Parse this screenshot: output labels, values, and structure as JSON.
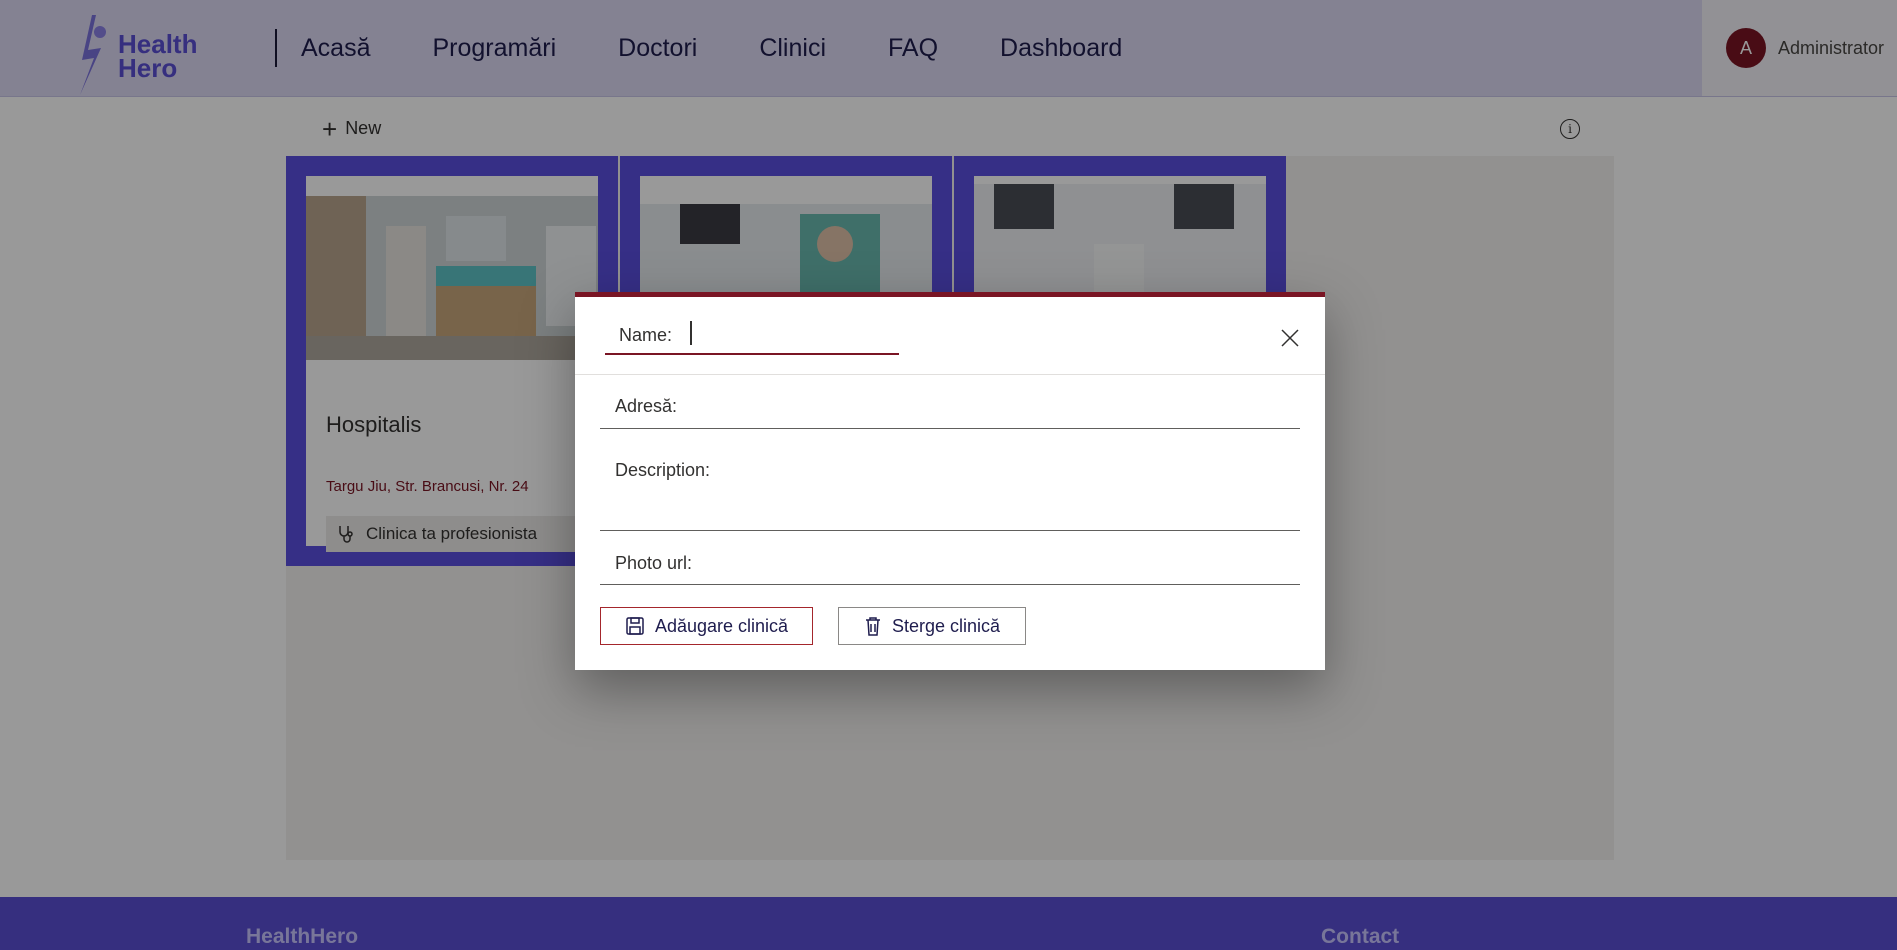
{
  "header": {
    "logo_line1": "Health",
    "logo_line2": "Hero",
    "nav": [
      "Acasă",
      "Programări",
      "Doctori",
      "Clinici",
      "FAQ",
      "Dashboard"
    ],
    "user_initial": "A",
    "user_name": "Administrator"
  },
  "toolbar": {
    "new_label": "New",
    "info_glyph": "i"
  },
  "cards": [
    {
      "title": "Hospitalis",
      "address": "Targu Jiu, Str. Brancusi, Nr. 24",
      "tag": "Clinica ta profesionista"
    },
    {
      "title": "",
      "address": "",
      "tag": ""
    },
    {
      "title": "",
      "address": "",
      "tag": ""
    }
  ],
  "modal": {
    "name_label": "Name:",
    "address_label": "Adresă:",
    "description_label": "Description:",
    "photo_label": "Photo url:",
    "save_label": "Adăugare clinică",
    "delete_label": "Sterge clinică"
  },
  "footer": {
    "brand": "HealthHero",
    "contact": "Contact"
  },
  "colors": {
    "accent": "#5b4fe0",
    "brand_red": "#7a1524",
    "header_bg": "#dcd9f4"
  }
}
